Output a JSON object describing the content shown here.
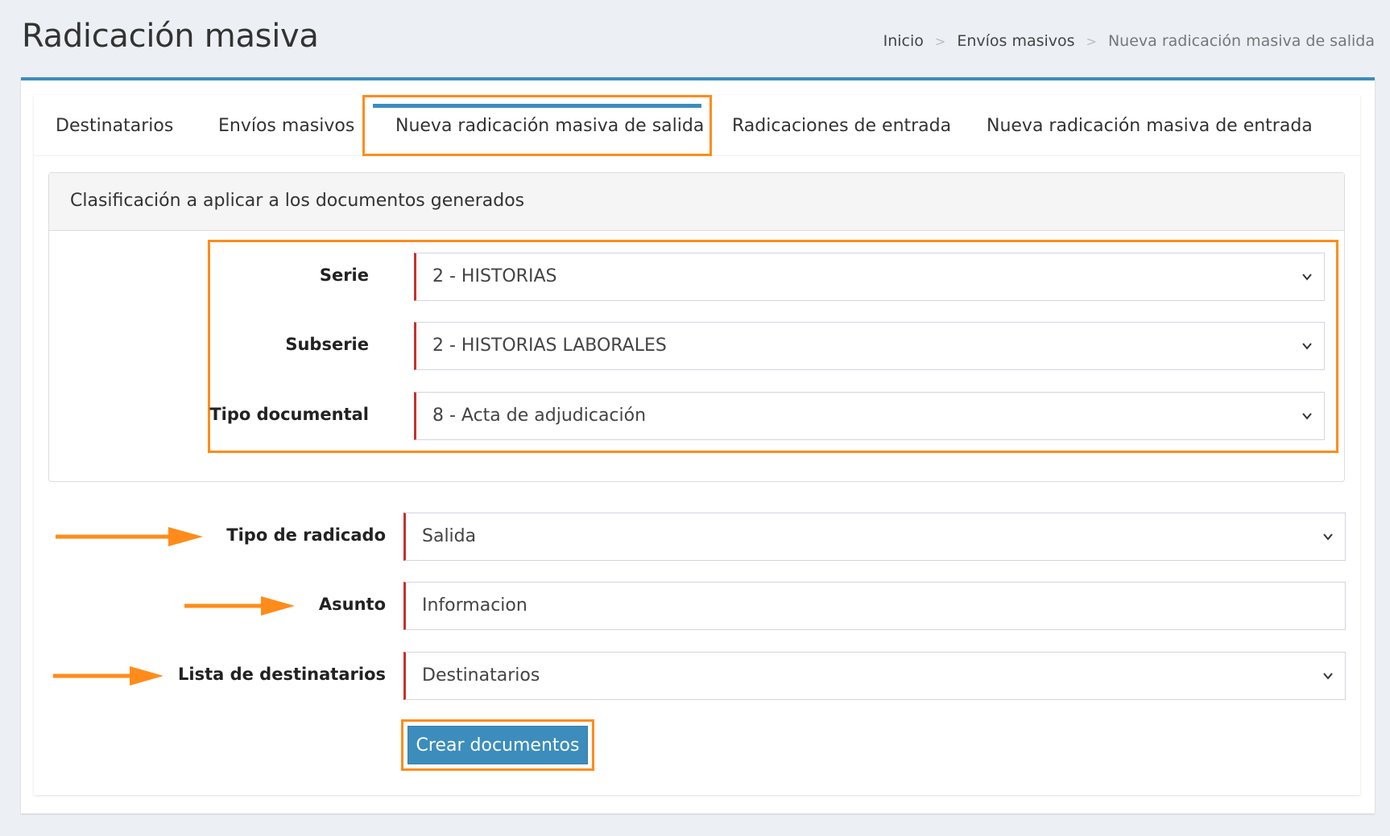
{
  "header": {
    "title": "Radicación masiva"
  },
  "breadcrumb": {
    "items": [
      "Inicio",
      "Envíos masivos",
      "Nueva radicación masiva de salida"
    ],
    "separator": ">"
  },
  "tabs": [
    {
      "label": "Destinatarios"
    },
    {
      "label": "Envíos masivos"
    },
    {
      "label": "Nueva radicación masiva de salida"
    },
    {
      "label": "Radicaciones de entrada"
    },
    {
      "label": "Nueva radicación masiva de entrada"
    }
  ],
  "panel": {
    "heading": "Clasificación a aplicar a los documentos generados",
    "fields": {
      "serie": {
        "label": "Serie",
        "value": "2 - HISTORIAS"
      },
      "subserie": {
        "label": "Subserie",
        "value": "2 - HISTORIAS LABORALES"
      },
      "tipo_documental": {
        "label": "Tipo documental",
        "value": "8 - Acta de adjudicación"
      }
    }
  },
  "form": {
    "tipo_radicado": {
      "label": "Tipo de radicado",
      "value": "Salida"
    },
    "asunto": {
      "label": "Asunto",
      "value": "Informacion"
    },
    "lista_destinatarios": {
      "label": "Lista de destinatarios",
      "value": "Destinatarios"
    },
    "submit_label": "Crear documentos"
  },
  "colors": {
    "accent": "#3c8dbc",
    "highlight": "#ff8c1a",
    "required": "#c9302c"
  }
}
